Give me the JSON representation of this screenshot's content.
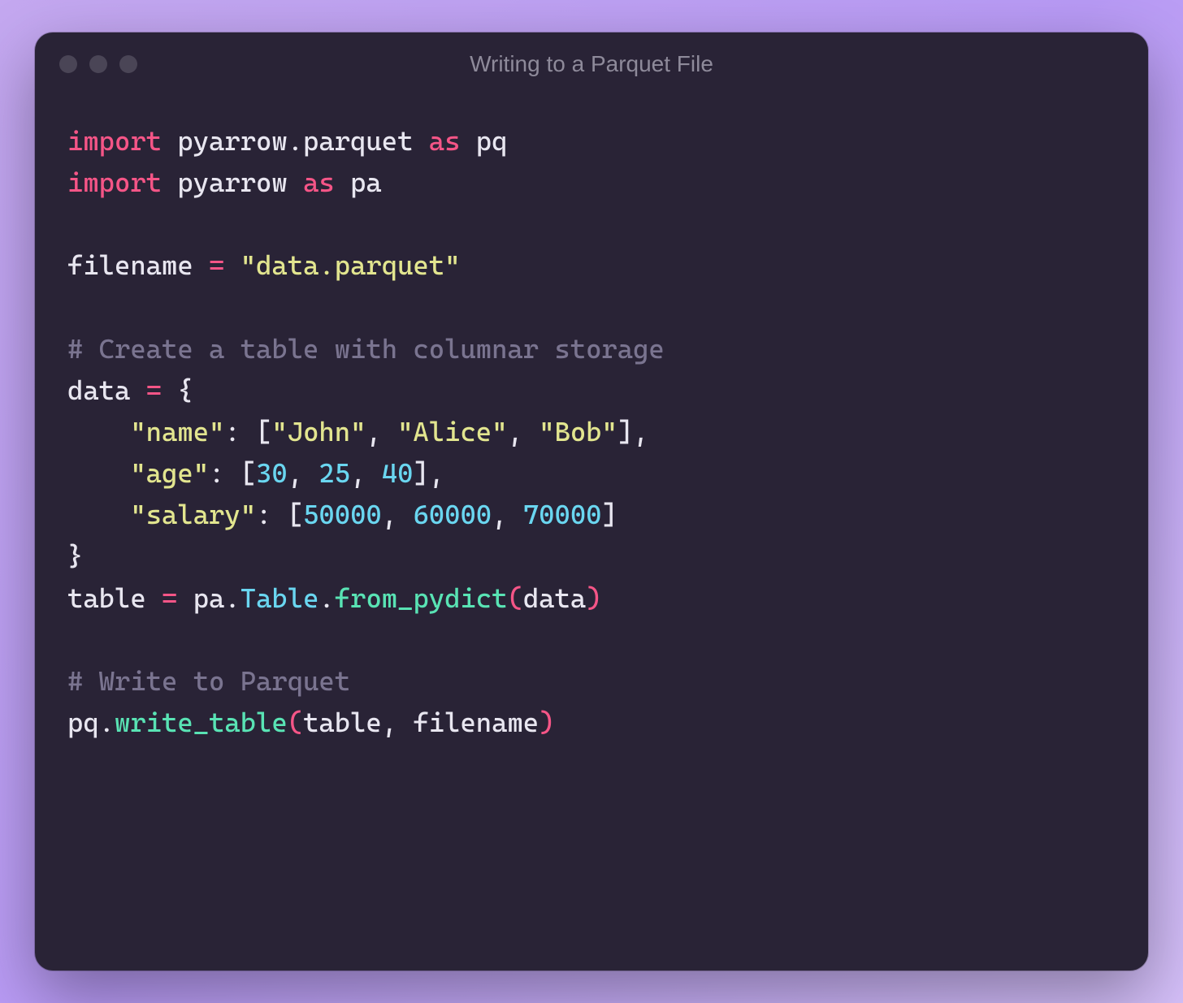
{
  "window": {
    "title": "Writing to a Parquet File",
    "traffic_lights": [
      "close",
      "minimize",
      "zoom"
    ]
  },
  "code": {
    "line1": {
      "kw_import": "import",
      "module": "pyarrow.parquet",
      "kw_as": "as",
      "alias": "pq"
    },
    "line2": {
      "kw_import": "import",
      "module": "pyarrow",
      "kw_as": "as",
      "alias": "pa"
    },
    "line4": {
      "var": "filename",
      "op": "=",
      "str": "\"data.parquet\""
    },
    "line6": {
      "comment": "# Create a table with columnar storage"
    },
    "line7": {
      "var": "data",
      "op": "=",
      "brace": "{"
    },
    "line8": {
      "indent": "    ",
      "key": "\"name\"",
      "colon": ":",
      "lb": "[",
      "v1": "\"John\"",
      "c1": ",",
      "v2": "\"Alice\"",
      "c2": ",",
      "v3": "\"Bob\"",
      "rb": "]",
      "tc": ","
    },
    "line9": {
      "indent": "    ",
      "key": "\"age\"",
      "colon": ":",
      "lb": "[",
      "n1": "30",
      "c1": ",",
      "n2": "25",
      "c2": ",",
      "n3": "40",
      "rb": "]",
      "tc": ","
    },
    "line10": {
      "indent": "    ",
      "key": "\"salary\"",
      "colon": ":",
      "lb": "[",
      "n1": "50000",
      "c1": ",",
      "n2": "60000",
      "c2": ",",
      "n3": "70000",
      "rb": "]"
    },
    "line11": {
      "brace": "}"
    },
    "line12": {
      "var": "table",
      "op": "=",
      "obj": "pa",
      "dot1": ".",
      "cls": "Table",
      "dot2": ".",
      "fn": "from_pydict",
      "lp": "(",
      "arg": "data",
      "rp": ")"
    },
    "line14": {
      "comment": "# Write to Parquet"
    },
    "line15": {
      "obj": "pq",
      "dot": ".",
      "fn": "write_table",
      "lp": "(",
      "a1": "table",
      "c": ",",
      "a2": "filename",
      "rp": ")"
    }
  }
}
